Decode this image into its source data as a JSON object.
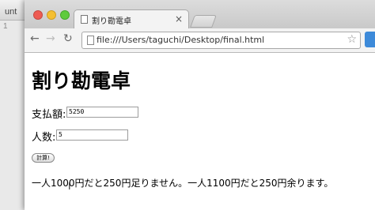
{
  "background_editor": {
    "tab_label": "unt",
    "line_number": "1"
  },
  "browser": {
    "tab": {
      "title": "割り勘電卓",
      "close_glyph": "×"
    },
    "toolbar": {
      "back_glyph": "←",
      "forward_glyph": "→",
      "reload_glyph": "↻",
      "url": "file:///Users/taguchi/Desktop/final.html",
      "bookmark_glyph": "☆"
    }
  },
  "page": {
    "title": "割り勘電卓",
    "amount": {
      "label": "支払額:",
      "value": "5250"
    },
    "people": {
      "label": "人数:",
      "value": "5"
    },
    "calc_button_label": "計算!",
    "result_text": "一人1000円だと250円足りません。一人1100円だと250円余ります。",
    "cursor_glyph": "I"
  },
  "colors": {
    "close": "#ee5b52",
    "minimize": "#f5bf32",
    "maximize": "#5fcb3c",
    "extension": "#3d8ad9"
  },
  "icons": [
    "page-icon",
    "back-arrow-icon",
    "forward-arrow-icon",
    "reload-icon",
    "star-icon",
    "extension-icon",
    "text-cursor-icon"
  ]
}
